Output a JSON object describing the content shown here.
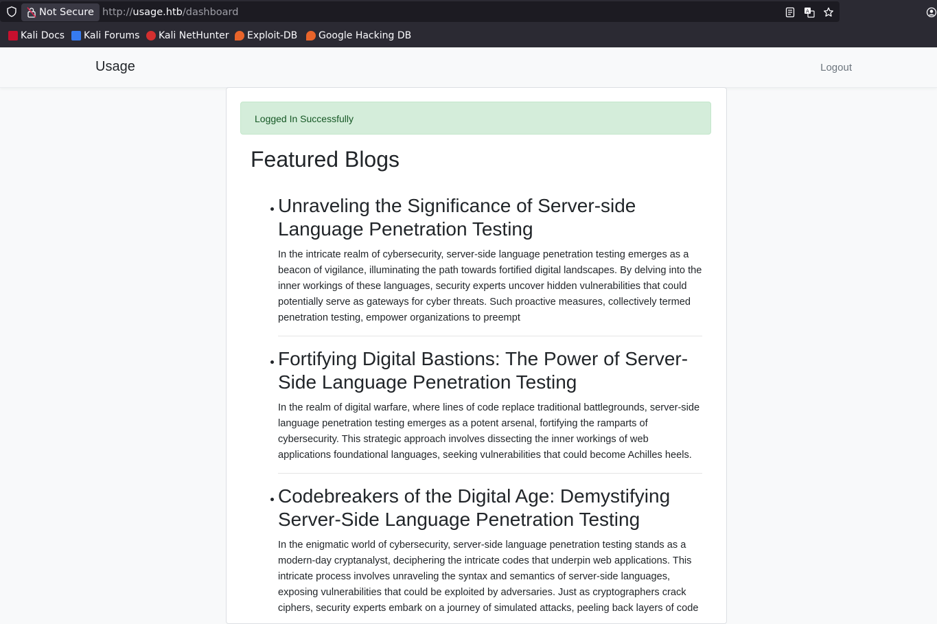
{
  "browser": {
    "security_label": "Not Secure",
    "url_scheme": "http://",
    "url_host": "usage.htb",
    "url_path": "/dashboard",
    "bookmarks": [
      {
        "label": "Kali Docs",
        "icon": "kali-docs-icon",
        "color": "#c8102e"
      },
      {
        "label": "Kali Forums",
        "icon": "kali-forums-icon",
        "color": "#367bf0"
      },
      {
        "label": "Kali NetHunter",
        "icon": "kali-nethunter-icon",
        "color": "#d32f2f"
      },
      {
        "label": "Exploit-DB",
        "icon": "exploit-db-icon",
        "color": "#e8642a"
      },
      {
        "label": "Google Hacking DB",
        "icon": "ghdb-icon",
        "color": "#e8642a"
      }
    ]
  },
  "navbar": {
    "brand": "Usage",
    "logout_label": "Logout"
  },
  "alert": {
    "message": "Logged In Successfully",
    "color": "#155724"
  },
  "main": {
    "heading": "Featured Blogs",
    "blogs": [
      {
        "title": "Unraveling the Significance of Server-side Language Penetration Testing",
        "body": "In the intricate realm of cybersecurity, server-side language penetration testing emerges as a beacon of vigilance, illuminating the path towards fortified digital landscapes. By delving into the inner workings of these languages, security experts uncover hidden vulnerabilities that could potentially serve as gateways for cyber threats. Such proactive measures, collectively termed penetration testing, empower organizations to preempt"
      },
      {
        "title": "Fortifying Digital Bastions: The Power of Server-Side Language Penetration Testing",
        "body": "In the realm of digital warfare, where lines of code replace traditional battlegrounds, server-side language penetration testing emerges as a potent arsenal, fortifying the ramparts of cybersecurity. This strategic approach involves dissecting the inner workings of web applications foundational languages, seeking vulnerabilities that could become Achilles heels."
      },
      {
        "title": "Codebreakers of the Digital Age: Demystifying Server-Side Language Penetration Testing",
        "body": "In the enigmatic world of cybersecurity, server-side language penetration testing stands as a modern-day cryptanalyst, deciphering the intricate codes that underpin web applications. This intricate process involves unraveling the syntax and semantics of server-side languages, exposing vulnerabilities that could be exploited by adversaries. Just as cryptographers crack ciphers, security experts embark on a journey of simulated attacks, peeling back layers of code"
      }
    ]
  }
}
